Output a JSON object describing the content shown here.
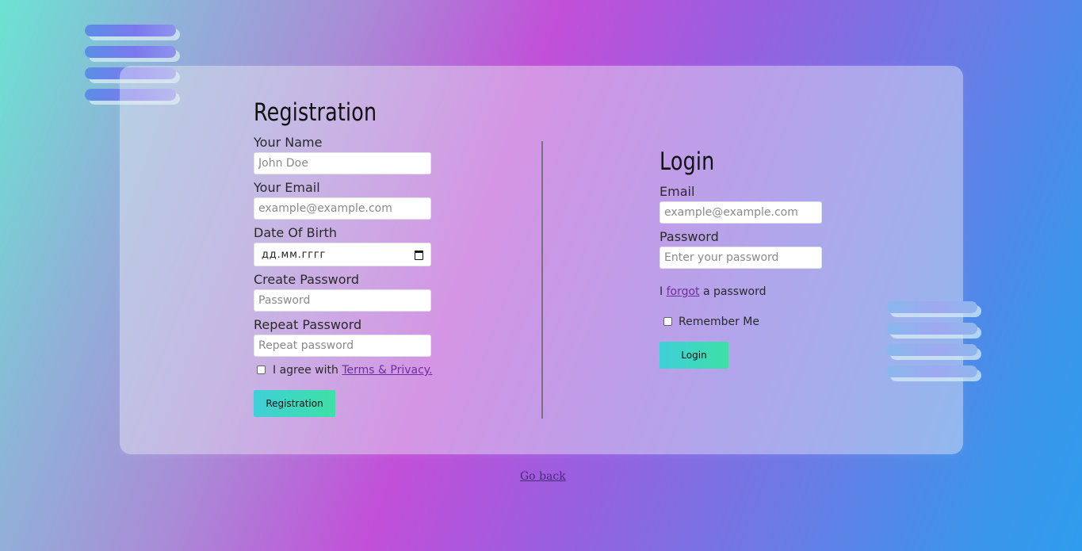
{
  "registration": {
    "title": "Registration",
    "name_label": "Your Name",
    "name_placeholder": "John Doe",
    "email_label": "Your Email",
    "email_placeholder": "example@example.com",
    "dob_label": "Date Of Birth",
    "dob_placeholder": "дд.мм.гггг",
    "password_label": "Create Password",
    "password_placeholder": "Password",
    "repeat_label": "Repeat Password",
    "repeat_placeholder": "Repeat password",
    "agree_prefix": "I agree with ",
    "terms_link": "Terms & Privacy.",
    "button": "Registration"
  },
  "login": {
    "title": "Login",
    "email_label": "Email",
    "email_placeholder": "example@example.com",
    "password_label": "Password",
    "password_placeholder": "Enter your password",
    "forgot_prefix": "I ",
    "forgot_link": "forgot",
    "forgot_suffix": " a password",
    "remember_label": "Remember Me",
    "button": "Login"
  },
  "footer": {
    "go_back": "Go back"
  },
  "icons": {
    "date_picker": "calendar-icon"
  },
  "colors": {
    "button_gradient_start": "#3fcfd8",
    "button_gradient_end": "#3ee0a6",
    "link": "#6a2f9c"
  }
}
